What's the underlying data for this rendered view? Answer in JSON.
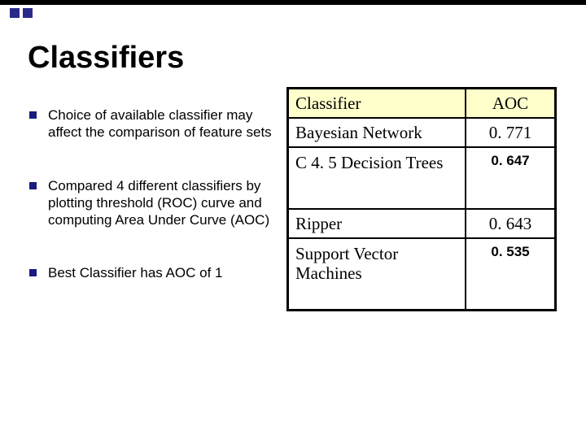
{
  "title": "Classifiers",
  "bullets": [
    "Choice of available classifier may affect the comparison of feature sets",
    "Compared 4 different classifiers by plotting threshold (ROC) curve and computing Area Under Curve (AOC)",
    "Best Classifier has AOC of 1"
  ],
  "table": {
    "headers": {
      "col1": "Classifier",
      "col2": "AOC"
    },
    "rows": [
      {
        "name": "Bayesian Network",
        "aoc": "0. 771",
        "style": "serif"
      },
      {
        "name": "C 4. 5 Decision Trees",
        "aoc": "0. 647",
        "style": "sans"
      },
      {
        "name": "Ripper",
        "aoc": "0. 643",
        "style": "serif"
      },
      {
        "name": "Support Vector Machines",
        "aoc": "0. 535",
        "style": "sans"
      }
    ]
  }
}
